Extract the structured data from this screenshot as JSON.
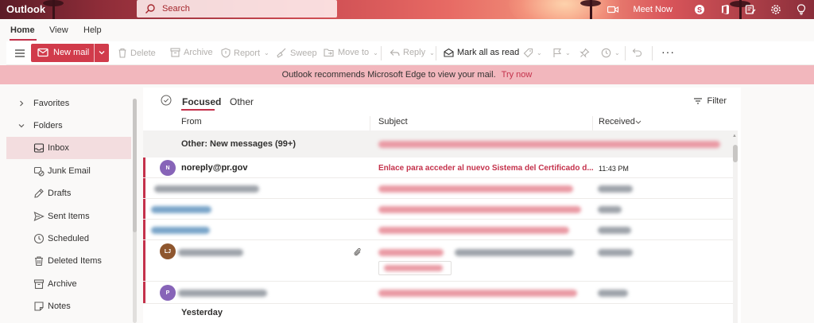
{
  "app": {
    "name": "Outlook"
  },
  "search": {
    "placeholder": "Search"
  },
  "header": {
    "meet_now_label": "Meet Now",
    "icons": [
      "meet-now-camera-icon",
      "skype-icon",
      "office-icon",
      "feedback-icon",
      "settings-gear-icon",
      "tips-lightbulb-icon"
    ]
  },
  "tabs": [
    {
      "label": "Home",
      "active": true
    },
    {
      "label": "View"
    },
    {
      "label": "Help"
    }
  ],
  "ribbon": {
    "new_mail": "New mail",
    "delete": "Delete",
    "archive": "Archive",
    "report": "Report",
    "sweep": "Sweep",
    "move_to": "Move to",
    "reply": "Reply",
    "mark_all_read": "Mark all as read",
    "more": "···"
  },
  "edge_banner": {
    "message": "Outlook recommends Microsoft Edge to view your mail.",
    "link": "Try now"
  },
  "sidebar": {
    "favorites": "Favorites",
    "folders": "Folders",
    "items": [
      {
        "label": "Inbox",
        "icon": "inbox-icon",
        "selected": true
      },
      {
        "label": "Junk Email",
        "icon": "junk-icon"
      },
      {
        "label": "Drafts",
        "icon": "drafts-pencil-icon"
      },
      {
        "label": "Sent Items",
        "icon": "sent-icon"
      },
      {
        "label": "Scheduled",
        "icon": "clock-icon"
      },
      {
        "label": "Deleted Items",
        "icon": "trash-icon"
      },
      {
        "label": "Archive",
        "icon": "archive-icon"
      },
      {
        "label": "Notes",
        "icon": "notes-icon"
      }
    ]
  },
  "list": {
    "focused_tab": "Focused",
    "other_tab": "Other",
    "filter": "Filter",
    "columns": {
      "from": "From",
      "subject": "Subject",
      "received": "Received"
    },
    "group_other": "Other: New messages (99+)",
    "messages": [
      {
        "avatar": "N",
        "avatar_color": "#8764b8",
        "from": "noreply@pr.gov",
        "subject": "Enlace para acceder al nuevo Sistema del Certificado d...",
        "received": "11:43 PM"
      },
      {
        "avatar": "LJ",
        "avatar_color": "#8e562e"
      },
      {
        "avatar": "P",
        "avatar_color": "#8764b8"
      }
    ],
    "group_yesterday": "Yesterday"
  },
  "colors": {
    "accent": "#c4314b",
    "new_mail_bg": "#d13b4b",
    "banner_bg": "#f2b7bd",
    "selected_folder": "#f3dddf"
  }
}
